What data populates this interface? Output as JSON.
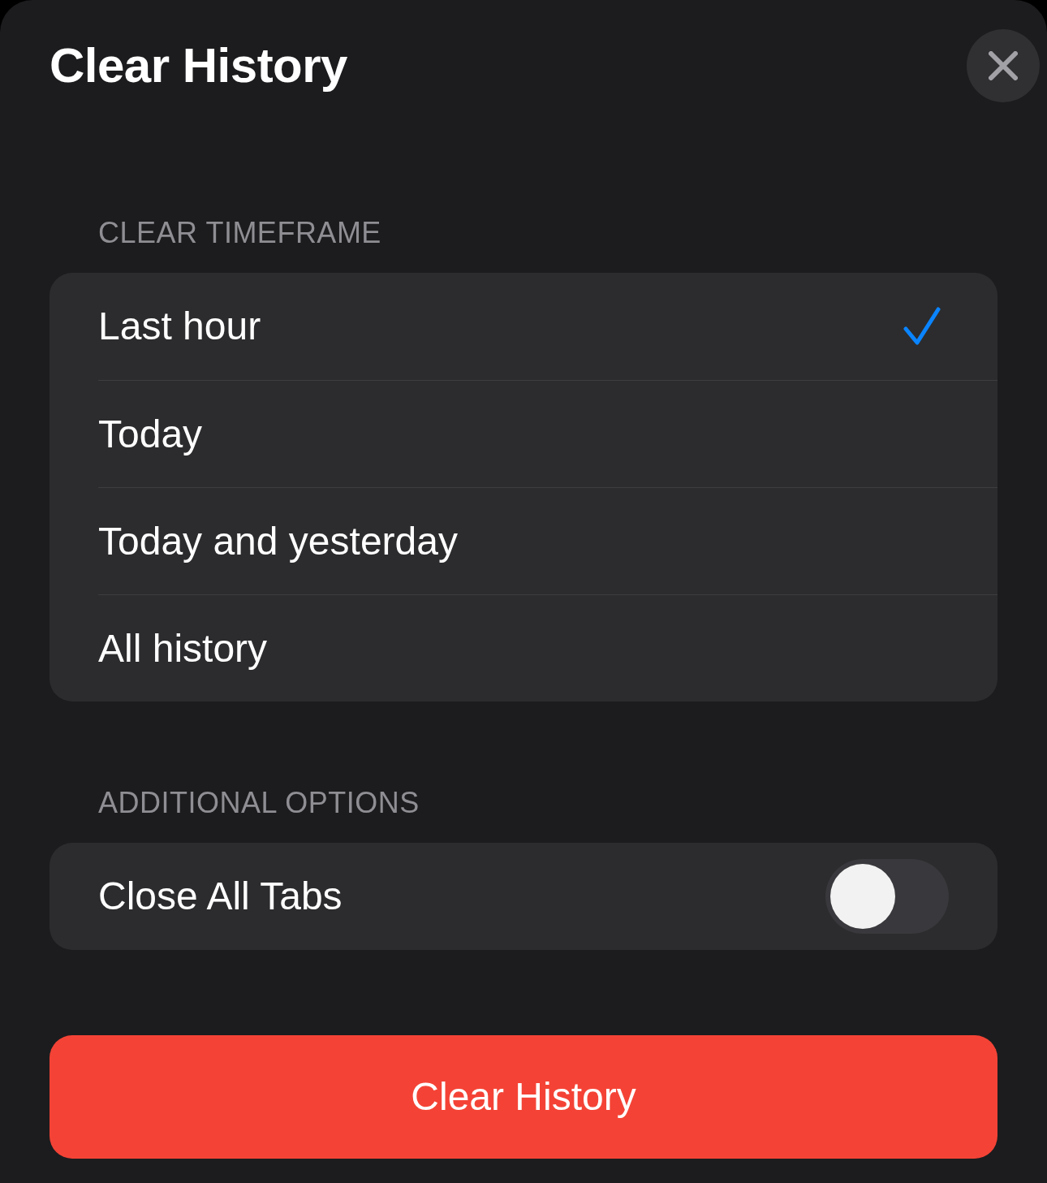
{
  "title": "Clear History",
  "timeframe": {
    "header": "CLEAR TIMEFRAME",
    "options": [
      {
        "label": "Last hour",
        "selected": true
      },
      {
        "label": "Today",
        "selected": false
      },
      {
        "label": "Today and yesterday",
        "selected": false
      },
      {
        "label": "All history",
        "selected": false
      }
    ]
  },
  "additional_options": {
    "header": "ADDITIONAL OPTIONS",
    "items": [
      {
        "label": "Close All Tabs",
        "on": false
      }
    ]
  },
  "action_button": {
    "label": "Clear History"
  }
}
